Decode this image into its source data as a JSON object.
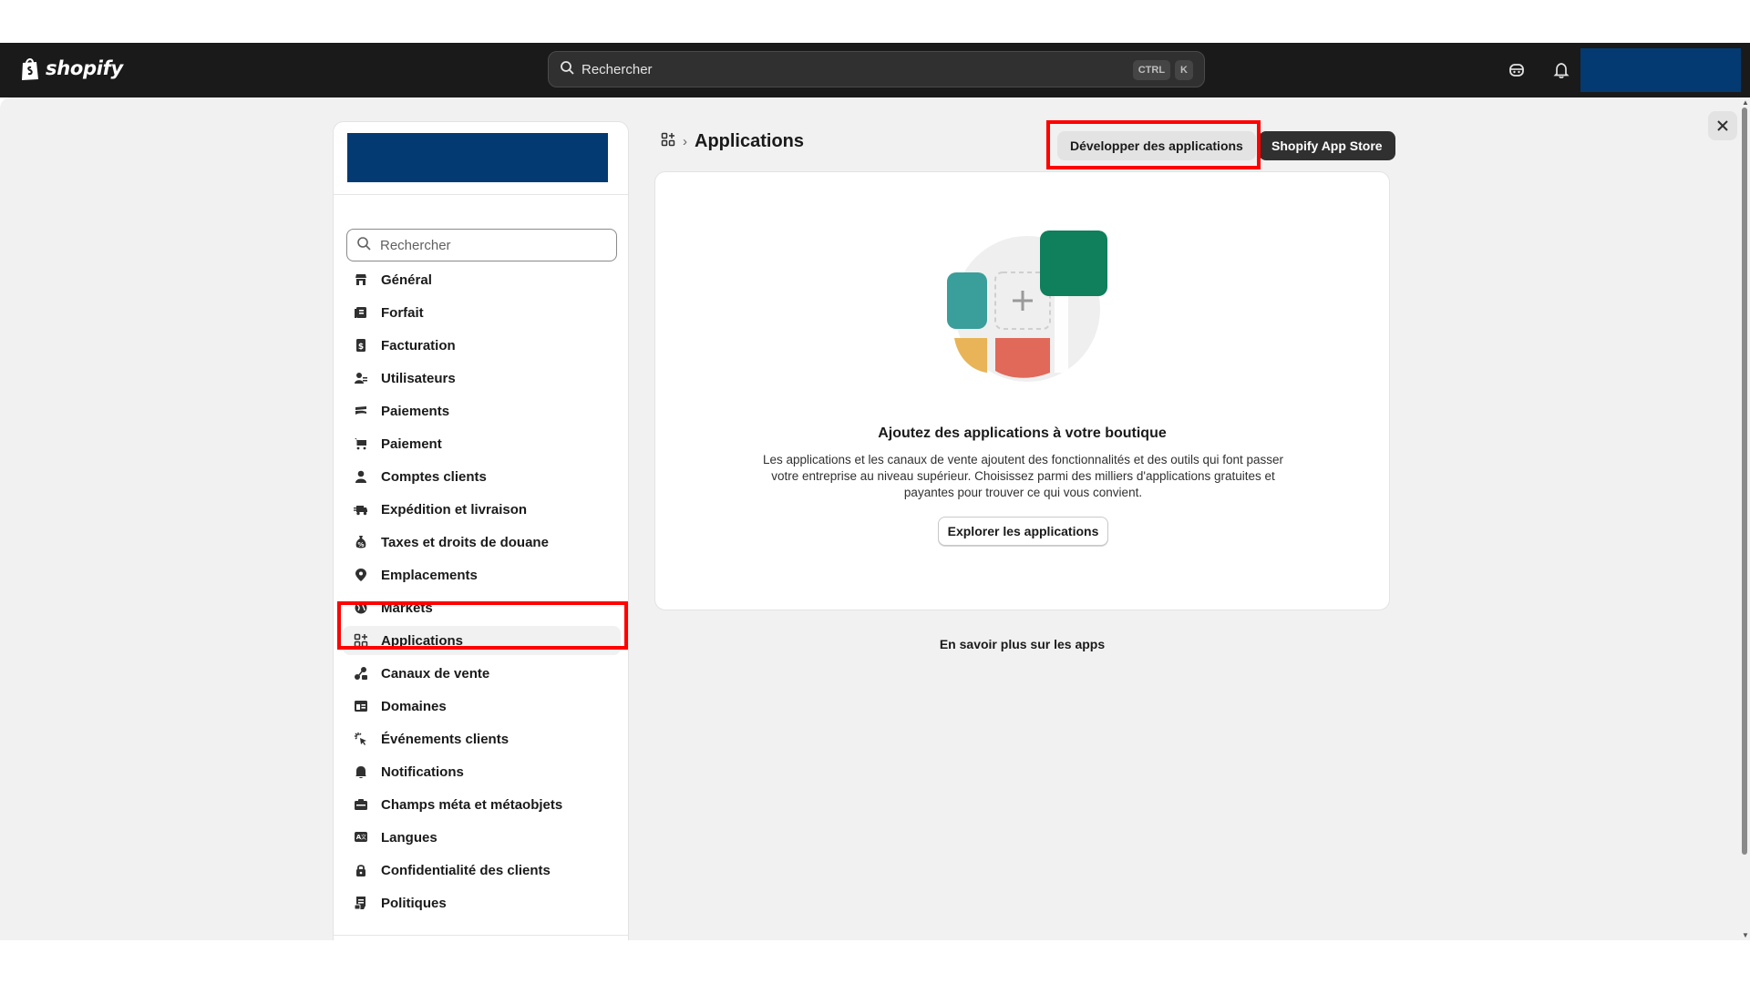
{
  "topbar": {
    "brand": "shopify",
    "search_label": "Rechercher",
    "shortcut_keys": [
      "CTRL",
      "K"
    ]
  },
  "sidebar": {
    "search_placeholder": "Rechercher",
    "items": [
      {
        "label": "Général",
        "icon": "store-icon"
      },
      {
        "label": "Forfait",
        "icon": "plan-icon"
      },
      {
        "label": "Facturation",
        "icon": "billing-icon"
      },
      {
        "label": "Utilisateurs",
        "icon": "users-icon"
      },
      {
        "label": "Paiements",
        "icon": "payments-icon"
      },
      {
        "label": "Paiement",
        "icon": "cart-icon"
      },
      {
        "label": "Comptes clients",
        "icon": "person-icon"
      },
      {
        "label": "Expédition et livraison",
        "icon": "truck-icon"
      },
      {
        "label": "Taxes et droits de douane",
        "icon": "tax-icon"
      },
      {
        "label": "Emplacements",
        "icon": "location-icon"
      },
      {
        "label": "Markets",
        "icon": "globe-icon"
      },
      {
        "label": "Applications",
        "icon": "apps-icon",
        "active": true
      },
      {
        "label": "Canaux de vente",
        "icon": "sales-channel-icon"
      },
      {
        "label": "Domaines",
        "icon": "domain-icon"
      },
      {
        "label": "Événements clients",
        "icon": "cursor-click-icon"
      },
      {
        "label": "Notifications",
        "icon": "bell-icon"
      },
      {
        "label": "Champs méta et métaobjets",
        "icon": "metafield-icon"
      },
      {
        "label": "Langues",
        "icon": "language-icon"
      },
      {
        "label": "Confidentialité des clients",
        "icon": "lock-icon"
      },
      {
        "label": "Politiques",
        "icon": "policy-icon"
      }
    ]
  },
  "main": {
    "title": "Applications",
    "develop_button": "Développer des applications",
    "app_store_button": "Shopify App Store",
    "card": {
      "heading": "Ajoutez des applications à votre boutique",
      "description": "Les applications et les canaux de vente ajoutent des fonctionnalités et des outils qui font passer votre entreprise au niveau supérieur. Choisissez parmi des milliers d'applications gratuites et payantes pour trouver ce qui vous convient.",
      "explore_button": "Explorer les applications"
    },
    "learn_more": "En savoir plus sur les apps"
  },
  "colors": {
    "topbar": "#1a1a1a",
    "highlight": "#ff0000",
    "redacted": "#033a72",
    "illus_green": "#0f7f5c",
    "illus_teal": "#3a9e9a",
    "illus_yellow": "#e8b457",
    "illus_red": "#e0695a"
  }
}
